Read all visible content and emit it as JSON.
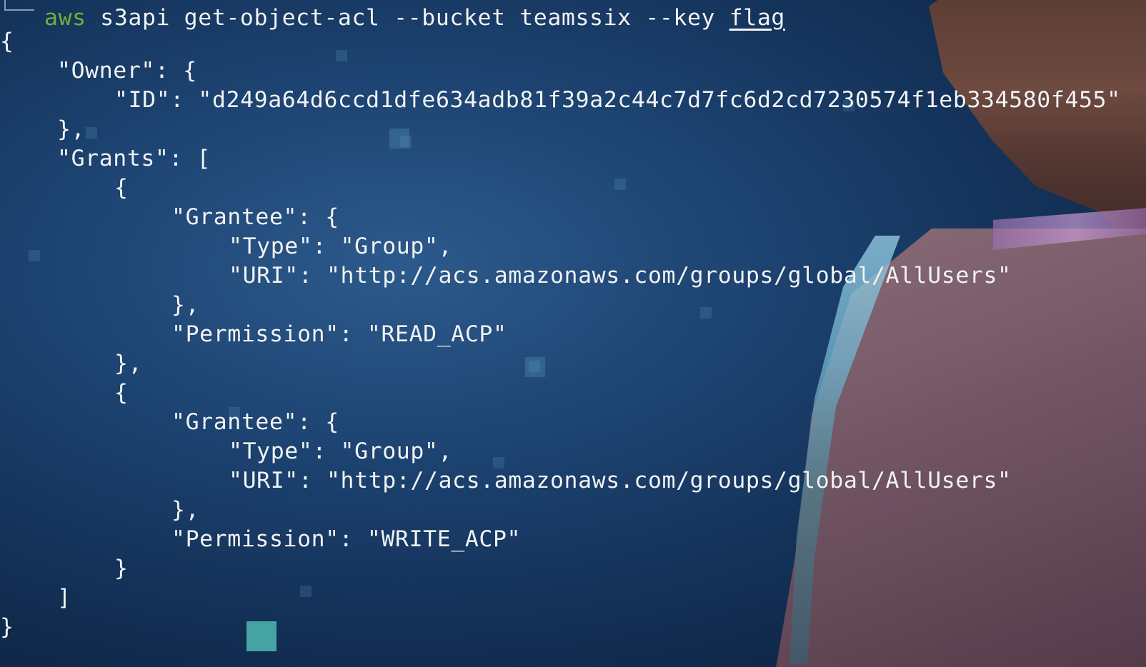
{
  "command": {
    "executable": "aws",
    "args": "s3api get-object-acl --bucket teamssix --key ",
    "last_arg": "flag"
  },
  "output_lines": [
    {
      "indent": 0,
      "text": "{"
    },
    {
      "indent": 1,
      "text": "\"Owner\": {"
    },
    {
      "indent": 2,
      "text": "\"ID\": \"d249a64d6ccd1dfe634adb81f39a2c44c7d7fc6d2cd7230574f1eb334580f455\""
    },
    {
      "indent": 1,
      "text": "},"
    },
    {
      "indent": 1,
      "text": "\"Grants\": ["
    },
    {
      "indent": 2,
      "text": "{"
    },
    {
      "indent": 3,
      "text": "\"Grantee\": {"
    },
    {
      "indent": 4,
      "text": "\"Type\": \"Group\","
    },
    {
      "indent": 4,
      "text": "\"URI\": \"http://acs.amazonaws.com/groups/global/AllUsers\""
    },
    {
      "indent": 3,
      "text": "},"
    },
    {
      "indent": 3,
      "text": "\"Permission\": \"READ_ACP\""
    },
    {
      "indent": 2,
      "text": "},"
    },
    {
      "indent": 2,
      "text": "{"
    },
    {
      "indent": 3,
      "text": "\"Grantee\": {"
    },
    {
      "indent": 4,
      "text": "\"Type\": \"Group\","
    },
    {
      "indent": 4,
      "text": "\"URI\": \"http://acs.amazonaws.com/groups/global/AllUsers\""
    },
    {
      "indent": 3,
      "text": "},"
    },
    {
      "indent": 3,
      "text": "\"Permission\": \"WRITE_ACP\""
    },
    {
      "indent": 2,
      "text": "}"
    },
    {
      "indent": 1,
      "text": "]"
    },
    {
      "indent": 0,
      "text": "}"
    }
  ],
  "colors": {
    "background": "#1c4270",
    "text": "#f1f3f5",
    "command_executable": "#6fb23a"
  }
}
